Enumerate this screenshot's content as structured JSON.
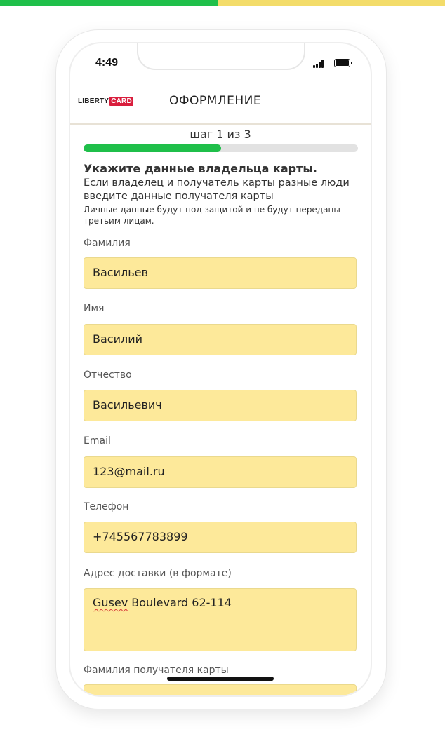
{
  "status_bar": {
    "time": "4:49"
  },
  "header": {
    "logo_liberty": "LIBERTY",
    "logo_card": "CARD",
    "title": "ОФОРМЛЕНИЕ"
  },
  "progress": {
    "step_text": "шаг 1 из 3",
    "fraction": 0.5,
    "colors": {
      "done": "#1fbf4a",
      "remaining": "#e2e2e2"
    }
  },
  "intro": {
    "title": "Укажите данные владельца карты.",
    "text": "Если владелец и получатель карты разные люди введите данные получателя карты",
    "note": "Личные данные будут под защитой и не будут переданы третьим лицам."
  },
  "form": {
    "fields": [
      {
        "label": "Фамилия",
        "value": "Васильев"
      },
      {
        "label": "Имя",
        "value": "Василий"
      },
      {
        "label": "Отчество",
        "value": "Васильевич"
      },
      {
        "label": "Email",
        "value": "123@mail.ru"
      },
      {
        "label": "Телефон",
        "value": "+745567783899"
      },
      {
        "label": "Адрес доставки (в формате)",
        "value_word1": "Gusev",
        "value_rest": " Boulevard 62-114"
      },
      {
        "label": "Фамилия получателя карты",
        "value": ""
      }
    ],
    "input_bg": "#fde99a"
  },
  "icons": {
    "signal": "cellular-signal-icon",
    "battery": "battery-icon"
  },
  "brand_colors": {
    "green": "#1fbf4a",
    "yellow": "#f3dc6a",
    "card_red": "#d91e3d"
  }
}
